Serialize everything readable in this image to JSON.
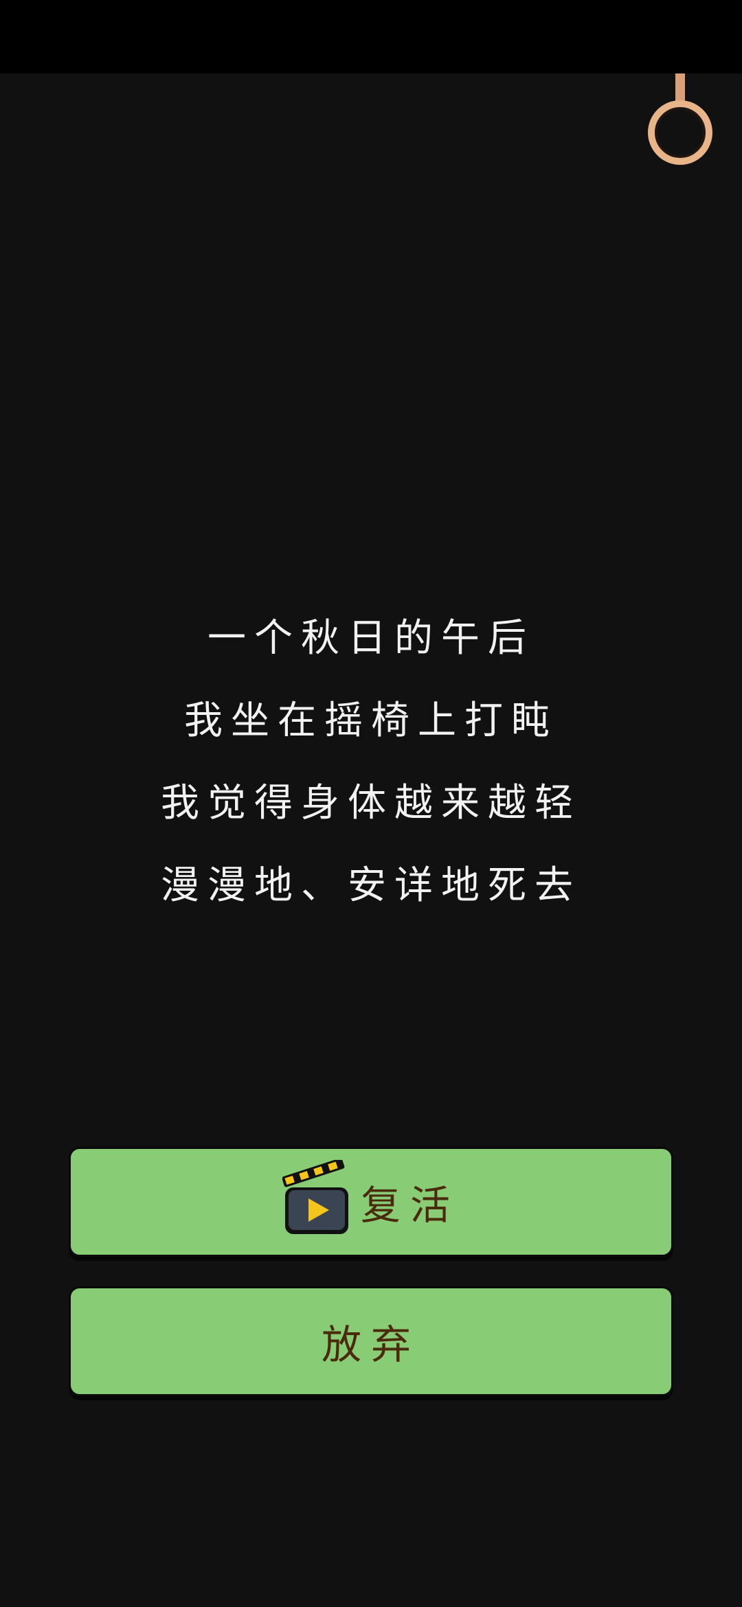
{
  "story": {
    "lines": [
      "一个秋日的午后",
      "我坐在摇椅上打盹",
      "我觉得身体越来越轻",
      "漫漫地、安详地死去"
    ]
  },
  "buttons": {
    "revive_label": "复活",
    "giveup_label": "放弃"
  },
  "icons": {
    "top_right": "ring-icon",
    "revive": "video-clapper-icon"
  },
  "colors": {
    "background": "#111111",
    "button": "#88cc76",
    "button_text": "#4a2a0c",
    "ring": "#e8b48a",
    "clapper_stripe": "#f5c51b",
    "play": "#f5c51b"
  }
}
